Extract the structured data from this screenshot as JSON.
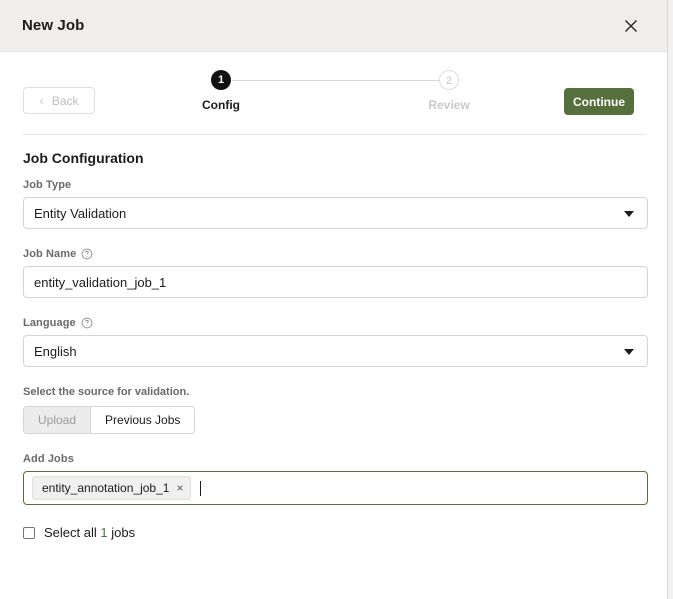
{
  "header": {
    "title": "New Job",
    "close_icon": "close-icon"
  },
  "stepper": {
    "back_label": "Back",
    "back_chevron": "‹",
    "continue_label": "Continue",
    "steps": [
      {
        "number": "1",
        "label": "Config",
        "state": "active"
      },
      {
        "number": "2",
        "label": "Review",
        "state": "inactive"
      }
    ]
  },
  "form": {
    "section_title": "Job Configuration",
    "job_type": {
      "label": "Job Type",
      "value": "Entity Validation"
    },
    "job_name": {
      "label": "Job Name",
      "help_icon": "help-circle-icon",
      "value": "entity_validation_job_1"
    },
    "language": {
      "label": "Language",
      "help_icon": "help-circle-icon",
      "value": "English"
    },
    "source": {
      "hint": "Select the source for validation.",
      "options": [
        {
          "label": "Upload",
          "selected": false
        },
        {
          "label": "Previous Jobs",
          "selected": true
        }
      ]
    },
    "add_jobs": {
      "label": "Add Jobs",
      "chips": [
        {
          "label": "entity_annotation_job_1",
          "remove_icon": "×"
        }
      ],
      "placeholder": ""
    },
    "select_all": {
      "prefix": "Select all ",
      "count": "1",
      "suffix": " jobs",
      "checked": false
    }
  },
  "colors": {
    "accent_green": "#55703c",
    "header_bg": "#efeeec",
    "step_active": "#111111"
  }
}
